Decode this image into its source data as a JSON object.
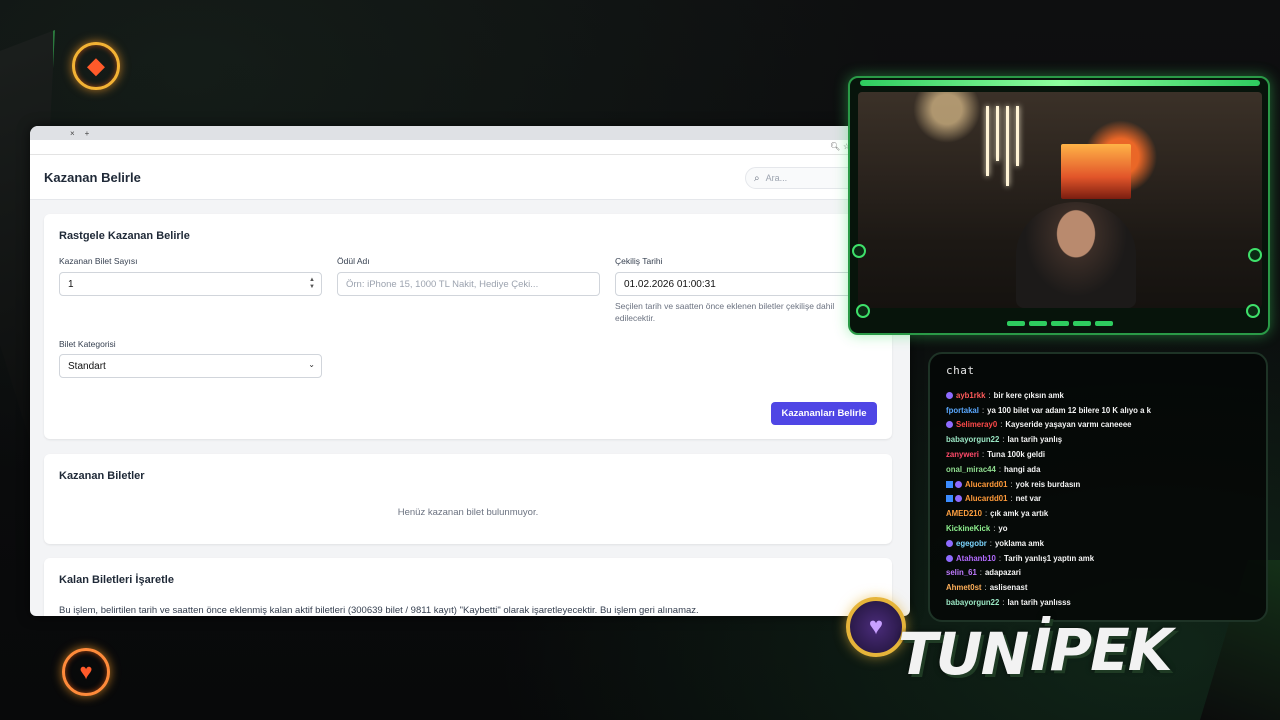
{
  "browser": {
    "tab_close": "×",
    "tab_new": "+",
    "header_title": "Kazanan Belirle",
    "search_placeholder": "Ara..."
  },
  "random_card": {
    "title": "Rastgele Kazanan Belirle",
    "ticket_count_label": "Kazanan Bilet Sayısı",
    "ticket_count_value": "1",
    "prize_label": "Ödül Adı",
    "prize_placeholder": "Örn: iPhone 15, 1000 TL Nakit, Hediye Çeki...",
    "draw_date_label": "Çekiliş Tarihi",
    "draw_date_value": "01.02.2026 01:00:31",
    "draw_date_help_1": "Seçilen tarih ve saatten önce eklenen biletler çekilişe dahil",
    "draw_date_help_2": "edilecektir.",
    "category_label": "Bilet Kategorisi",
    "category_value": "Standart",
    "submit_label": "Kazananları Belirle"
  },
  "winners_card": {
    "title": "Kazanan Biletler",
    "empty_text": "Henüz kazanan bilet bulunmuyor."
  },
  "mark_card": {
    "title": "Kalan Biletleri İşaretle",
    "description": "Bu işlem, belirtilen tarih ve saatten önce eklenmiş kalan aktif biletleri (300639 bilet / 9811 kayıt) \"Kaybetti\" olarak işaretleyecektir. Bu işlem geri alınamaz."
  },
  "chat": {
    "title": "chat",
    "messages": [
      {
        "user": "ayb1rkk",
        "color": "#ff5a5a",
        "badge": "sub",
        "text": "bir kere çıksın amk"
      },
      {
        "user": "fportakal",
        "color": "#5aa8ff",
        "badge": "",
        "text": "ya 100 bilet var adam 12 bilere 10 K alıyo a k"
      },
      {
        "user": "Selimeray0",
        "color": "#ff4a4a",
        "badge": "sub",
        "text": "Kayseride yaşayan varmı caneeee"
      },
      {
        "user": "babayorgun22",
        "color": "#9be7c4",
        "badge": "",
        "text": "lan tarih yanlış"
      },
      {
        "user": "zanyweri",
        "color": "#ff4a6a",
        "badge": "",
        "text": "Tuna 100k geldi"
      },
      {
        "user": "onal_mirac44",
        "color": "#8fdc8f",
        "badge": "",
        "text": "hangi ada"
      },
      {
        "user": "Alucardd01",
        "color": "#ff9a3a",
        "badge": "both",
        "text": "yok reis burdasın"
      },
      {
        "user": "Alucardd01",
        "color": "#ff9a3a",
        "badge": "both",
        "text": "net var"
      },
      {
        "user": "AMED210",
        "color": "#ffa040",
        "badge": "",
        "text": "çık amk ya artık"
      },
      {
        "user": "KickineKick",
        "color": "#8ef08e",
        "badge": "",
        "text": "yo"
      },
      {
        "user": "egegobr",
        "color": "#7cd6ff",
        "badge": "sub",
        "text": "yoklama amk"
      },
      {
        "user": "Atahanb10",
        "color": "#b36bff",
        "badge": "sub",
        "text": "Tarih yanlış1 yaptın amk"
      },
      {
        "user": "selin_61",
        "color": "#c07bff",
        "badge": "",
        "text": "adapazari"
      },
      {
        "user": "Ahmet0st",
        "color": "#ffb05a",
        "badge": "",
        "text": "aslisenast"
      },
      {
        "user": "babayorgun22",
        "color": "#9be7c4",
        "badge": "",
        "text": "lan tarih yanlısss"
      }
    ]
  },
  "logo": {
    "word1": "TUN",
    "word2": "İPEK"
  },
  "colors": {
    "accent": "#4f46e5",
    "cam_border": "#2a9a47",
    "coin": "#f3b234"
  }
}
